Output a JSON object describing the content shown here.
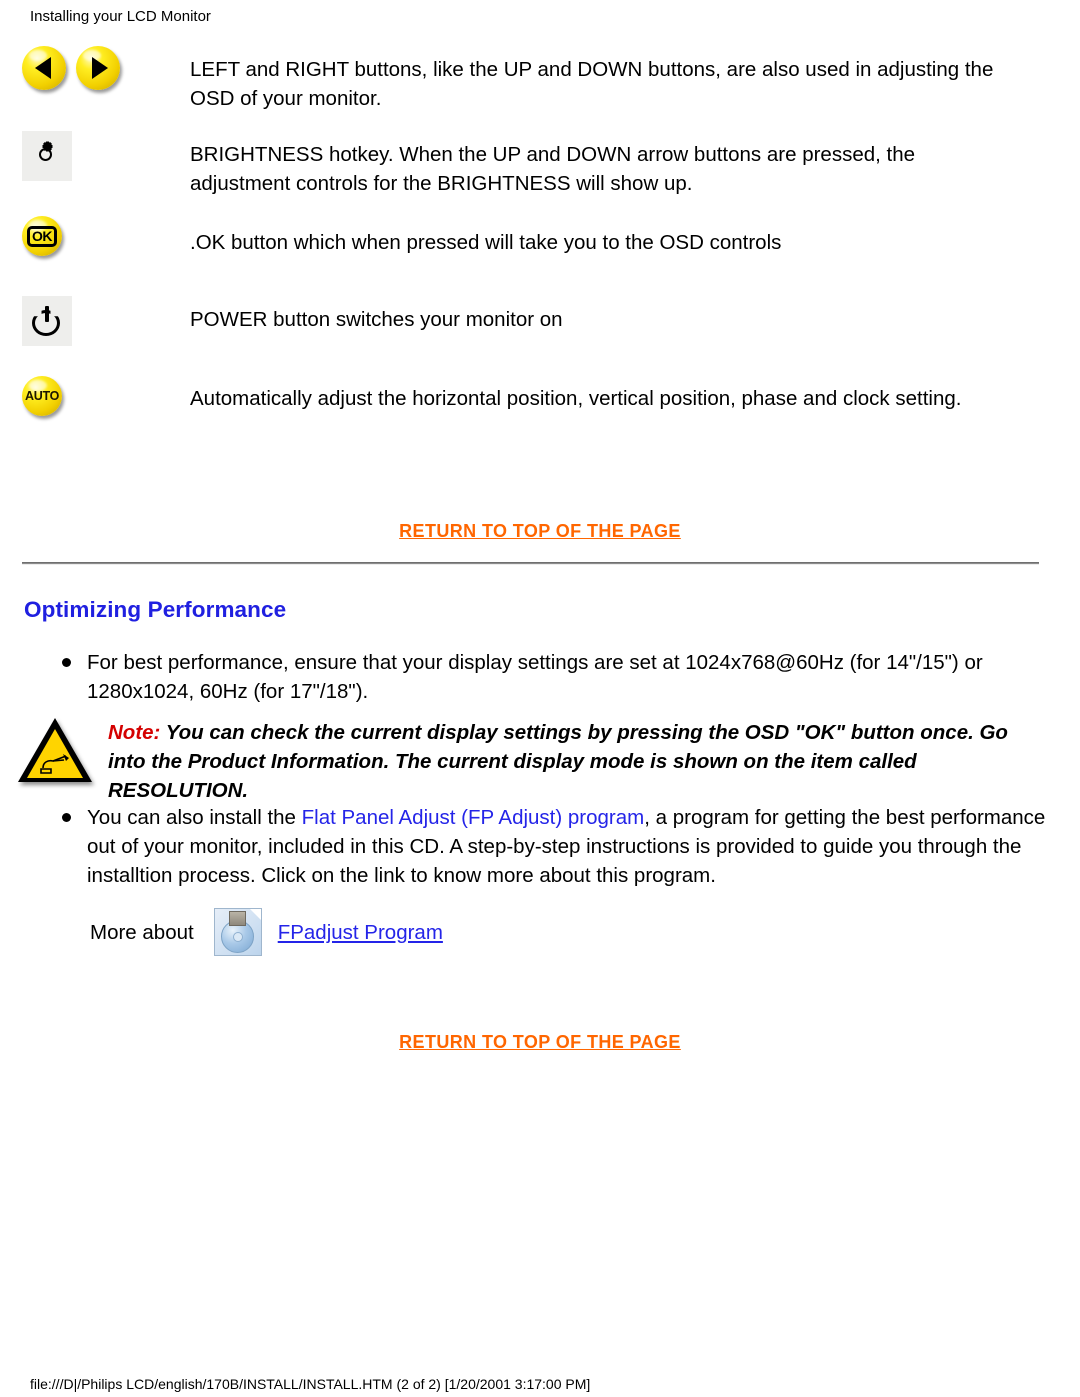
{
  "header": {
    "title": "Installing your LCD Monitor"
  },
  "button_rows": [
    {
      "icon": "left-right-arrow-buttons",
      "text": "LEFT and RIGHT buttons, like the UP and DOWN buttons, are also used in adjusting the OSD of your monitor."
    },
    {
      "icon": "brightness-hotkey-icon",
      "text": "BRIGHTNESS hotkey. When the UP and DOWN arrow buttons are pressed, the adjustment controls for the BRIGHTNESS will show up."
    },
    {
      "icon": "ok-button-icon",
      "label": "OK",
      "text": ".OK button which when pressed will take you to the OSD controls"
    },
    {
      "icon": "power-button-icon",
      "text": "POWER button switches your monitor on"
    },
    {
      "icon": "auto-button-icon",
      "label": "AUTO",
      "text": "Automatically adjust the horizontal position, vertical position, phase and clock setting."
    }
  ],
  "return_to_top": {
    "label": "RETURN TO TOP OF THE PAGE"
  },
  "section": {
    "title": "Optimizing Performance",
    "bullet_1": "For best performance, ensure that your display settings are set at 1024x768@60Hz (for 14\"/15\") or 1280x1024, 60Hz (for 17\"/18\").",
    "bullet_2_before": "You can also install the ",
    "bullet_2_link": "Flat Panel Adjust (FP Adjust) program",
    "bullet_2_after": ", a program for getting the best performance out of your monitor, included in this CD. A step-by-step instructions is provided to guide you through the installtion process. Click on the link to know more about this program."
  },
  "note": {
    "label": "Note:",
    "text": " You can check the current display settings by pressing the OSD \"OK\" button once. Go into the Product Information. The current display mode is shown on the item called RESOLUTION."
  },
  "more_about": {
    "label": "More about",
    "icon": "cd-disk-icon",
    "link": "FPadjust Program"
  },
  "footer": {
    "text": "file:///D|/Philips LCD/english/170B/INSTALL/INSTALL.HTM (2 of 2) [1/20/2001 3:17:00 PM]"
  },
  "colors": {
    "link_orange": "#ff6600",
    "heading_blue": "#2020e0",
    "link_blue": "#2424e8",
    "note_red": "#d40000",
    "button_yellow": "#ffee22"
  }
}
